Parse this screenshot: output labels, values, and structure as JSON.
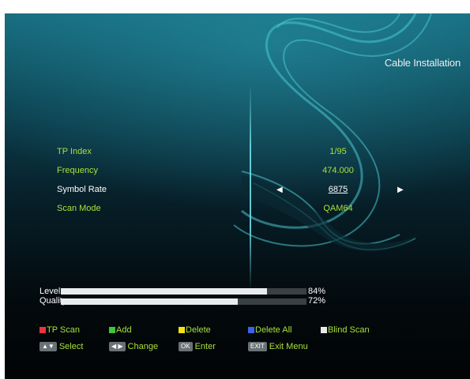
{
  "header": {
    "title": "Cable Installation"
  },
  "settings": [
    {
      "label": "TP Index",
      "value": "1/95"
    },
    {
      "label": "Frequency",
      "value": "474.000"
    },
    {
      "label": "Symbol Rate",
      "value": "6875",
      "selected": true
    },
    {
      "label": "Scan Mode",
      "value": "QAM64"
    }
  ],
  "signal": {
    "level": {
      "label": "Level",
      "percent_text": "84%",
      "percent": 84
    },
    "quality": {
      "label": "Quality",
      "percent_text": "72%",
      "percent": 72
    }
  },
  "color_keys": [
    {
      "label": "TP Scan",
      "color": "#e8343f"
    },
    {
      "label": "Add",
      "color": "#3fc43a"
    },
    {
      "label": "Delete",
      "color": "#f2e21a"
    },
    {
      "label": "Delete All",
      "color": "#3b62e8"
    },
    {
      "label": "Blind Scan",
      "color": "#e8e8e8"
    }
  ],
  "nav_keys": [
    {
      "key": "▲▼",
      "label": "Select"
    },
    {
      "key": "◀ ▶",
      "label": "Change"
    },
    {
      "key": "OK",
      "label": "Enter"
    },
    {
      "key": "EXIT",
      "label": "Exit Menu"
    }
  ]
}
